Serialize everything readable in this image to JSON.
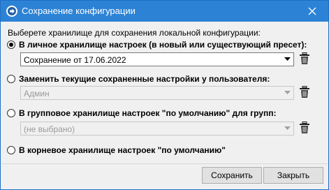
{
  "window": {
    "title": "Сохранение конфигурации",
    "accent_color": "#2c83d6",
    "app_icon": "arrow-right-circle-icon",
    "close_icon": "close-icon"
  },
  "prompt_label": "Выберете хранилище для сохранения локальной конфигурации:",
  "options": [
    {
      "label": "В личное хранилище настроек (в новый или существующий пресет):",
      "selected": true,
      "combo": {
        "value": "Сохранение от 17.06.2022",
        "enabled": true
      },
      "trash_icon": "trash-icon"
    },
    {
      "label": "Заменить текущие сохраненные настройки у пользователя:",
      "selected": false,
      "combo": {
        "value": "Админ",
        "enabled": false
      },
      "trash_icon": "trash-icon"
    },
    {
      "label": "В групповое хранилище настроек \"по умолчанию\" для  групп:",
      "selected": false,
      "combo": {
        "value": "(не выбрано)",
        "enabled": false
      },
      "trash_icon": "trash-icon"
    },
    {
      "label": "В корневое хранилище настроек \"по умолчанию\"",
      "selected": false
    }
  ],
  "buttons": {
    "save": "Сохранить",
    "close": "Закрыть"
  }
}
